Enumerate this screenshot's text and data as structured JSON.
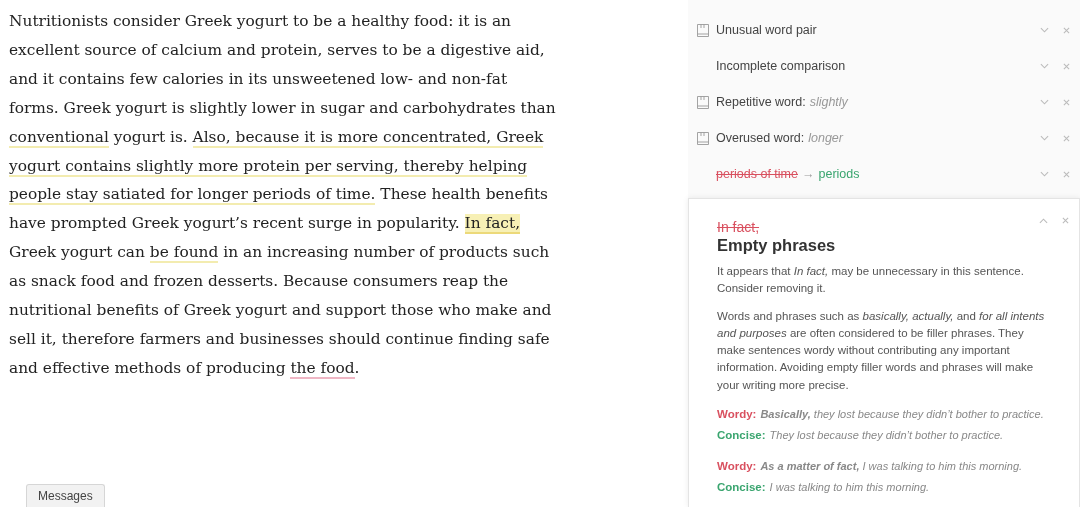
{
  "document": {
    "segments": [
      {
        "text": "Nutritionists consider Greek yogurt to be a healthy food: it is an excellent source of calcium and protein, serves to be a digestive aid, and it contains few calories in its unsweetened low- and non-fat forms. Greek yogurt is slightly lower in sugar and carbohydrates than ",
        "kind": "plain"
      },
      {
        "text": "conventional",
        "kind": "flag"
      },
      {
        "text": " yogurt is. ",
        "kind": "plain"
      },
      {
        "text": "Also, because it is more concentrated, Greek yogurt contains slightly more protein per serving, thereby helping people stay satiated for longer periods of time.",
        "kind": "flag"
      },
      {
        "text": " These health benefits have prompted Greek yogurt’s recent surge in popularity. ",
        "kind": "plain"
      },
      {
        "text": "In fact,",
        "kind": "active"
      },
      {
        "text": " Greek yogurt can ",
        "kind": "plain"
      },
      {
        "text": "be found",
        "kind": "flag"
      },
      {
        "text": " in an increasing number of products such as snack food and frozen desserts. Because consumers reap the nutritional benefits of Greek yogurt and support those who make and sell it, therefore farmers and businesses should continue finding safe and effective methods of producing ",
        "kind": "plain"
      },
      {
        "text": "the food",
        "kind": "critical"
      },
      {
        "text": ".",
        "kind": "plain"
      }
    ]
  },
  "messages_button": "Messages",
  "suggestions": [
    {
      "kind": "issue",
      "icon": true,
      "label": "Unusual word pair"
    },
    {
      "kind": "issue",
      "icon": false,
      "label": "Incomplete comparison"
    },
    {
      "kind": "issue",
      "icon": true,
      "label": "Repetitive word:",
      "detail": "slightly"
    },
    {
      "kind": "issue",
      "icon": true,
      "label": "Overused word:",
      "detail": "longer"
    },
    {
      "kind": "replace",
      "icon": false,
      "old": "periods of time",
      "arrow": "→",
      "new": "periods"
    }
  ],
  "expanded_card": {
    "removed": "In fact,",
    "title": "Empty phrases",
    "summary": "It appears that *In fact,* may be unnecessary in this sentence. Consider removing it.",
    "explanation": "Words and phrases such as *basically, actually,* and *for all intents and purposes* are often considered to be filler phrases. They make sentences wordy without contributing any important information. Avoiding empty filler words and phrases will make your writing more precise.",
    "examples": [
      {
        "kind": "wordy",
        "label": "Wordy:",
        "sentence": "**Basically,** they lost because they didn’t bother to practice."
      },
      {
        "kind": "concise",
        "label": "Concise:",
        "sentence": "They lost because they didn’t bother to practice."
      },
      {
        "kind": "wordy",
        "label": "Wordy:",
        "sentence": "**As a matter of fact,** I was talking to him this morning."
      },
      {
        "kind": "concise",
        "label": "Concise:",
        "sentence": "I was talking to him this morning."
      }
    ]
  }
}
